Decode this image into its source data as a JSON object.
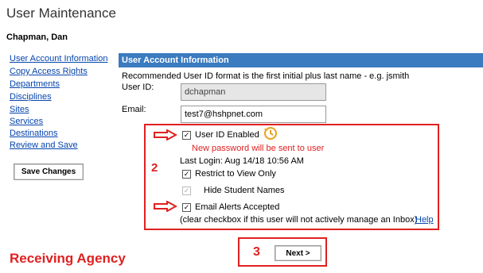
{
  "page": {
    "title": "User Maintenance",
    "user_name": "Chapman, Dan"
  },
  "sidebar": {
    "items": [
      {
        "label": "User Account Information"
      },
      {
        "label": "Copy Access Rights"
      },
      {
        "label": "Departments"
      },
      {
        "label": "Disciplines"
      },
      {
        "label": "Sites"
      },
      {
        "label": "Services"
      },
      {
        "label": "Destinations"
      },
      {
        "label": "Review and Save"
      }
    ],
    "save_label": "Save Changes"
  },
  "panel": {
    "header": "User Account Information",
    "recommendation": "Recommended User ID format is the first initial plus last name - e.g. jsmith",
    "userid_label": "User ID:",
    "userid_value": "dchapman",
    "email_label": "Email:",
    "email_value": "test7@hshpnet.com",
    "userid_enabled_label": "User ID Enabled",
    "warning": "New password will be sent to user",
    "last_login": "Last Login:  Aug 14/18 10:56 AM",
    "restrict_label": "Restrict to View Only",
    "hide_students_label": "Hide Student Names",
    "email_alerts_label": "Email Alerts Accepted",
    "clear_note": "(clear checkbox if this user will not actively manage an Inbox)",
    "help_label": "Help",
    "next_label": "Next >"
  },
  "annotations": {
    "step2": "2",
    "step3": "3",
    "caption": "Receiving Agency",
    "accent_color": "#e02020"
  },
  "checkboxes": {
    "userid_enabled": true,
    "restrict_view_only": true,
    "hide_student_names": true,
    "hide_student_names_disabled": true,
    "email_alerts": true
  }
}
